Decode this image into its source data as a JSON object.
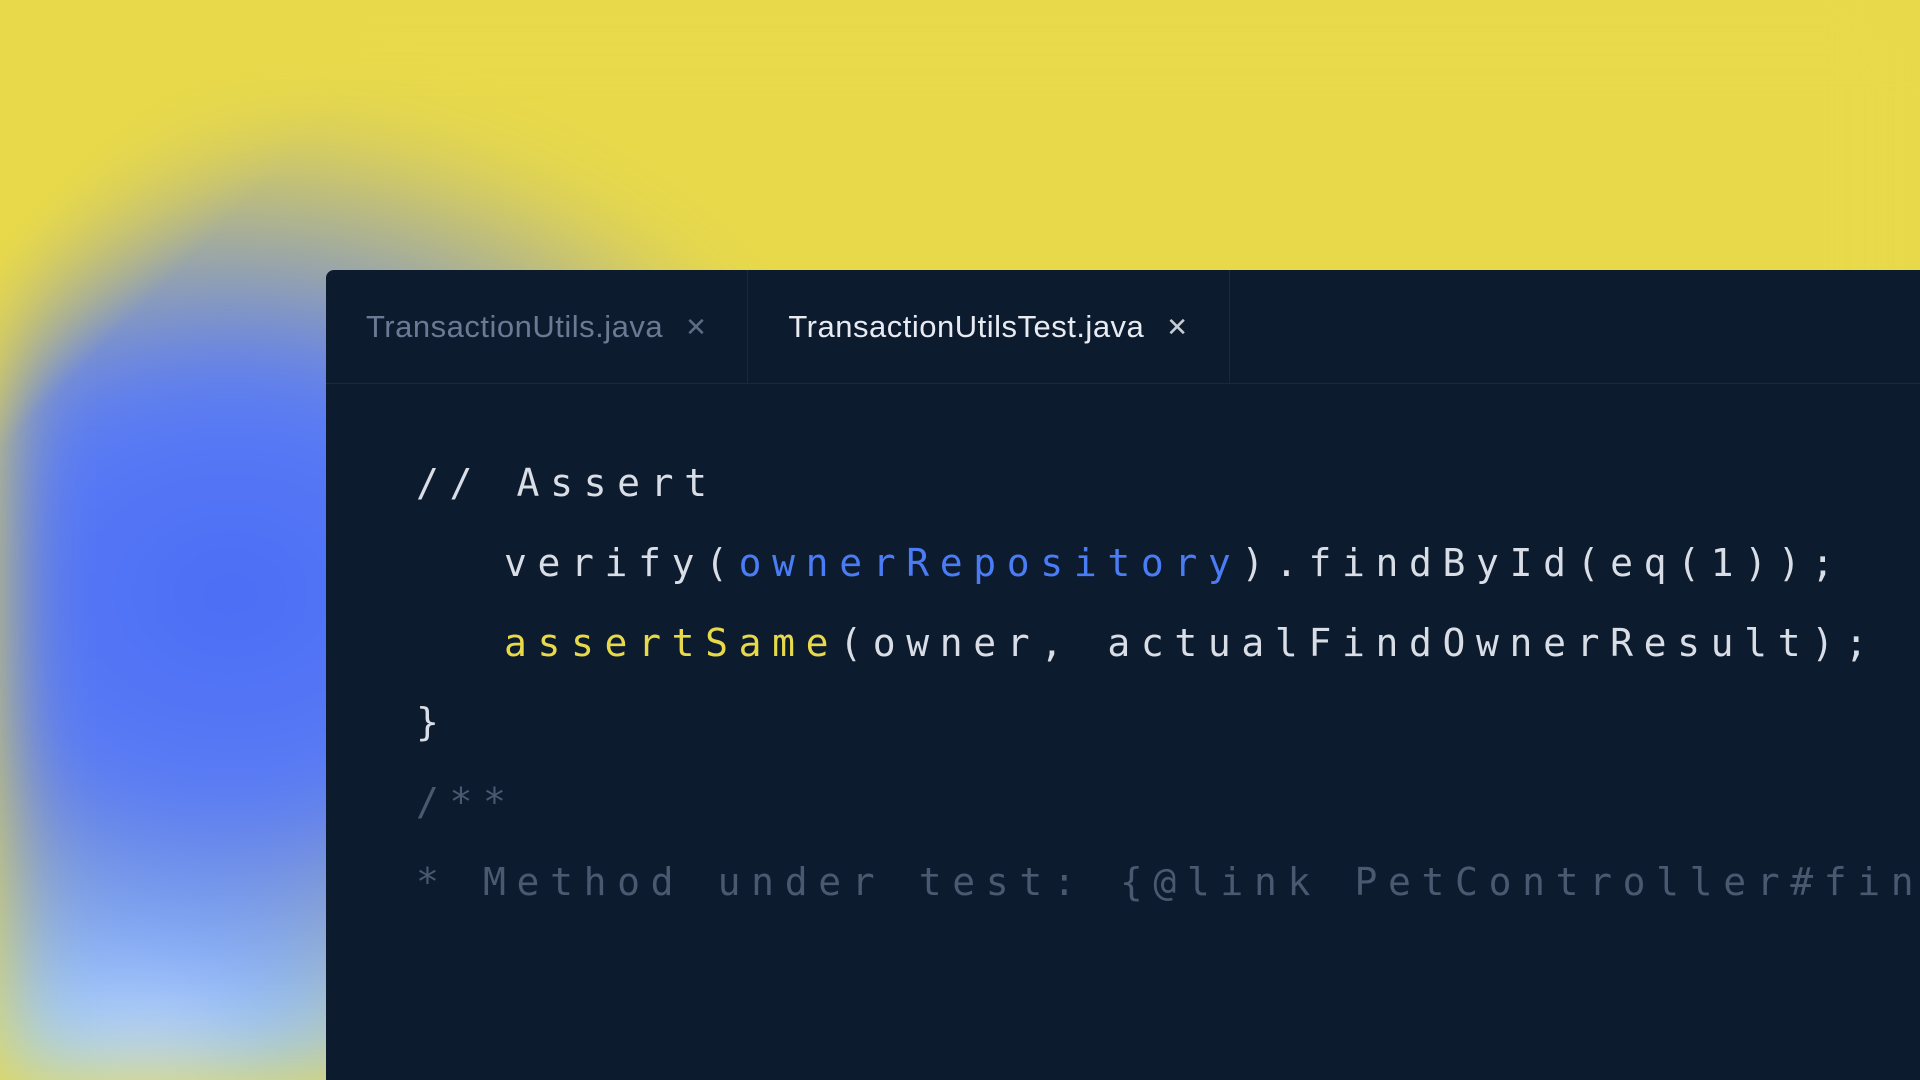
{
  "tabs": [
    {
      "label": "TransactionUtils.java",
      "active": false
    },
    {
      "label": "TransactionUtilsTest.java",
      "active": true
    }
  ],
  "code": {
    "line1_comment": "// Assert",
    "line2": {
      "prefix": "verify(",
      "highlighted": "ownerRepository",
      "suffix": ").findById(eq(1));"
    },
    "line3": {
      "highlighted": "assertSame",
      "suffix": "(owner, actualFindOwnerResult);"
    },
    "line4": "}",
    "line5": "/**",
    "line6": "* Method under test: {@link PetController#findOwner"
  }
}
